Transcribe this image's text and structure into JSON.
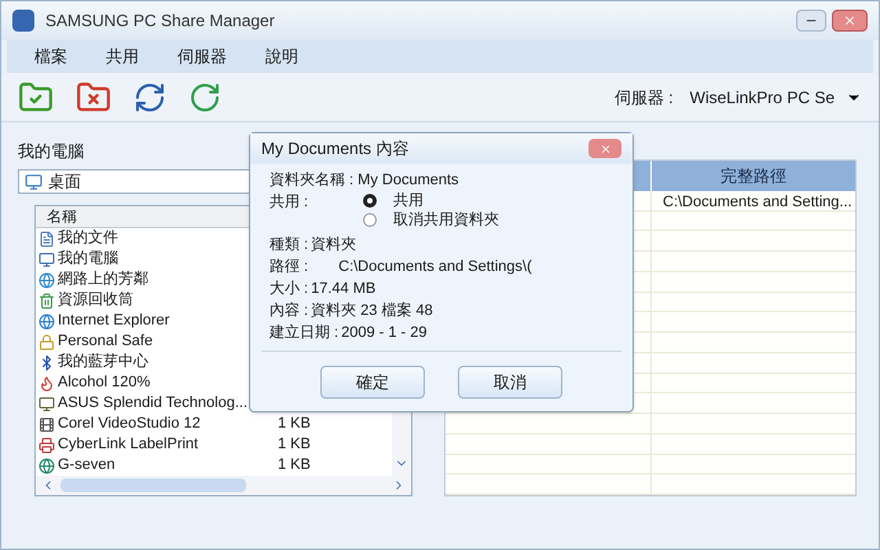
{
  "window": {
    "title": "SAMSUNG PC Share Manager"
  },
  "menu": [
    "檔案",
    "共用",
    "伺服器",
    "說明"
  ],
  "server": {
    "label": "伺服器 :",
    "value": "WiseLinkPro PC Se"
  },
  "left": {
    "title": "我的電腦",
    "location": "桌面",
    "column": "名稱",
    "items": [
      {
        "name": "我的文件"
      },
      {
        "name": "我的電腦"
      },
      {
        "name": "網路上的芳鄰"
      },
      {
        "name": "資源回收筒"
      },
      {
        "name": "Internet Explorer"
      },
      {
        "name": "Personal Safe"
      },
      {
        "name": "我的藍芽中心"
      },
      {
        "name": "Alcohol 120%"
      },
      {
        "name": "ASUS Splendid Technolog..."
      },
      {
        "name": "Corel VideoStudio 12",
        "size": "1 KB"
      },
      {
        "name": "CyberLink  LabelPrint",
        "size": "1 KB"
      },
      {
        "name": "G-seven",
        "size": "1 KB"
      }
    ]
  },
  "right": {
    "column": "完整路徑",
    "rows": [
      "C:\\Documents and Setting..."
    ]
  },
  "dialog": {
    "title": "My Documents  內容",
    "folder_name": "資料夾名稱 : My Documents",
    "share_label": "共用 :",
    "share_options": [
      {
        "label": "共用",
        "selected": true
      },
      {
        "label": "取消共用資料夾",
        "selected": false
      }
    ],
    "fields": [
      {
        "label": "種類 :",
        "value": "資料夾"
      },
      {
        "label": "路徑 :",
        "value": "C:\\Documents and Settings\\("
      },
      {
        "label": "大小 :",
        "value": "17.44 MB"
      },
      {
        "label": "內容 :",
        "value": "資料夾  23 檔案  48"
      },
      {
        "label": "建立日期 :",
        "value": "2009 - 1 - 29"
      }
    ],
    "buttons": [
      "確定",
      "取消"
    ]
  }
}
